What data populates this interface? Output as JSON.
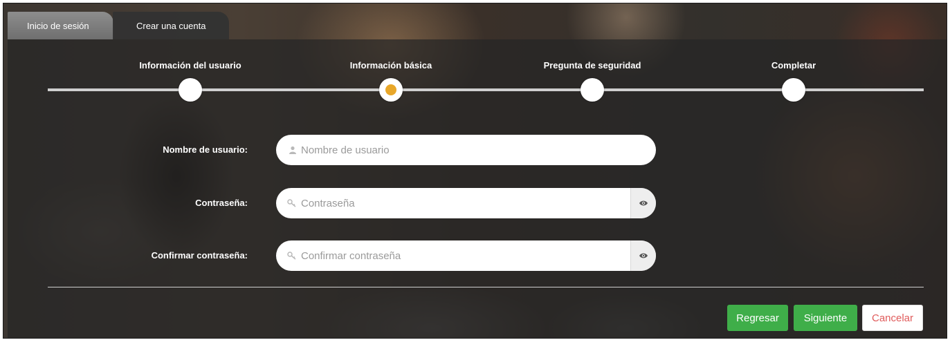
{
  "tabs": {
    "login": "Inicio de sesión",
    "create_account": "Crear una cuenta"
  },
  "steps": [
    {
      "label": "Información del usuario",
      "active": false
    },
    {
      "label": "Información básica",
      "active": true
    },
    {
      "label": "Pregunta de seguridad",
      "active": false
    },
    {
      "label": "Completar",
      "active": false
    }
  ],
  "form": {
    "username": {
      "label": "Nombre de usuario:",
      "placeholder": "Nombre de usuario",
      "value": "",
      "icon": "user-icon"
    },
    "password": {
      "label": "Contraseña:",
      "placeholder": "Contraseña",
      "value": "",
      "icon": "key-icon",
      "toggle_icon": "eye-icon"
    },
    "confirm_password": {
      "label": "Confirmar contraseña:",
      "placeholder": "Confirmar contraseña",
      "value": "",
      "icon": "key-icon",
      "toggle_icon": "eye-icon"
    }
  },
  "buttons": {
    "back": "Regresar",
    "next": "Siguiente",
    "cancel": "Cancelar"
  },
  "colors": {
    "primary_button": "#3fae49",
    "active_step": "#e8a72a",
    "cancel_text": "#e05b5b"
  }
}
